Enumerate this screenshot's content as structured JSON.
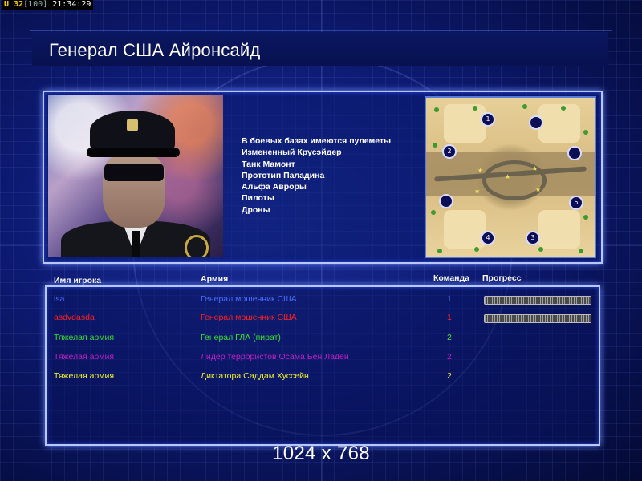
{
  "status": {
    "u_label": "U",
    "value_a": "32",
    "value_b": "[100]",
    "time": "21:34:29"
  },
  "title": "Генерал США Айронсайд",
  "features": [
    "В боевых базах имеются пулеметы",
    "Измененный Крусэйдер",
    "Танк Мамонт",
    "Прототип Паладина",
    "Альфа Авроры",
    "Пилоты",
    "Дроны"
  ],
  "map": {
    "markers": [
      "1",
      "2",
      "",
      "",
      "5",
      "4",
      "3",
      ""
    ],
    "colors": {
      "sand": "#e6cf98",
      "marker": "#0b0d55"
    }
  },
  "table": {
    "headers": {
      "player": "Имя игрока",
      "army": "Армия",
      "team": "Команда",
      "progress": "Прогресс"
    },
    "rows": [
      {
        "player": "isa",
        "army": "Генерал мошенник США",
        "team": "1",
        "color": "#4a6cff",
        "progress": 1.0
      },
      {
        "player": "asdvdasda",
        "army": "Генерал мошенник США",
        "team": "1",
        "color": "#ff2020",
        "progress": 1.0
      },
      {
        "player": "Тяжелая армия",
        "army": "Генерал ГЛА (пират)",
        "team": "2",
        "color": "#33e033",
        "progress": null
      },
      {
        "player": "Тяжелая армия",
        "army": "Лидер террористов Осама Бен Ладен",
        "team": "2",
        "color": "#c020c0",
        "progress": null
      },
      {
        "player": "Тяжелая армия",
        "army": "Диктатора Саддам Хуссейн",
        "team": "2",
        "color": "#f0f030",
        "progress": null
      }
    ]
  },
  "resolution": "1024 x 768"
}
